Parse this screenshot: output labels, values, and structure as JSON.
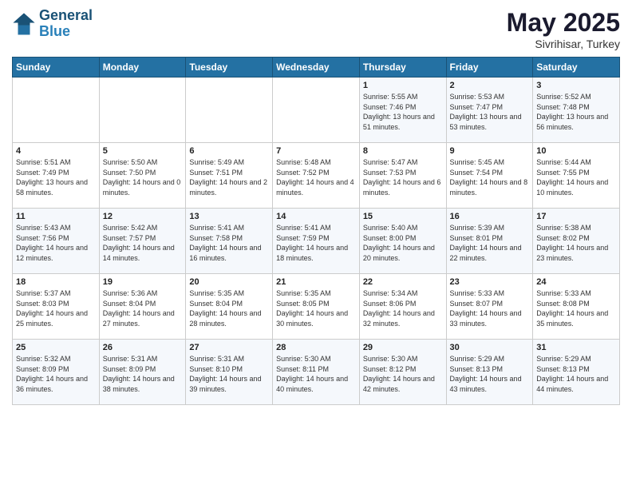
{
  "logo": {
    "line1": "General",
    "line2": "Blue"
  },
  "title": "May 2025",
  "subtitle": "Sivrihisar, Turkey",
  "days_header": [
    "Sunday",
    "Monday",
    "Tuesday",
    "Wednesday",
    "Thursday",
    "Friday",
    "Saturday"
  ],
  "weeks": [
    [
      {
        "day": "",
        "sunrise": "",
        "sunset": "",
        "daylight": ""
      },
      {
        "day": "",
        "sunrise": "",
        "sunset": "",
        "daylight": ""
      },
      {
        "day": "",
        "sunrise": "",
        "sunset": "",
        "daylight": ""
      },
      {
        "day": "",
        "sunrise": "",
        "sunset": "",
        "daylight": ""
      },
      {
        "day": "1",
        "sunrise": "Sunrise: 5:55 AM",
        "sunset": "Sunset: 7:46 PM",
        "daylight": "Daylight: 13 hours and 51 minutes."
      },
      {
        "day": "2",
        "sunrise": "Sunrise: 5:53 AM",
        "sunset": "Sunset: 7:47 PM",
        "daylight": "Daylight: 13 hours and 53 minutes."
      },
      {
        "day": "3",
        "sunrise": "Sunrise: 5:52 AM",
        "sunset": "Sunset: 7:48 PM",
        "daylight": "Daylight: 13 hours and 56 minutes."
      }
    ],
    [
      {
        "day": "4",
        "sunrise": "Sunrise: 5:51 AM",
        "sunset": "Sunset: 7:49 PM",
        "daylight": "Daylight: 13 hours and 58 minutes."
      },
      {
        "day": "5",
        "sunrise": "Sunrise: 5:50 AM",
        "sunset": "Sunset: 7:50 PM",
        "daylight": "Daylight: 14 hours and 0 minutes."
      },
      {
        "day": "6",
        "sunrise": "Sunrise: 5:49 AM",
        "sunset": "Sunset: 7:51 PM",
        "daylight": "Daylight: 14 hours and 2 minutes."
      },
      {
        "day": "7",
        "sunrise": "Sunrise: 5:48 AM",
        "sunset": "Sunset: 7:52 PM",
        "daylight": "Daylight: 14 hours and 4 minutes."
      },
      {
        "day": "8",
        "sunrise": "Sunrise: 5:47 AM",
        "sunset": "Sunset: 7:53 PM",
        "daylight": "Daylight: 14 hours and 6 minutes."
      },
      {
        "day": "9",
        "sunrise": "Sunrise: 5:45 AM",
        "sunset": "Sunset: 7:54 PM",
        "daylight": "Daylight: 14 hours and 8 minutes."
      },
      {
        "day": "10",
        "sunrise": "Sunrise: 5:44 AM",
        "sunset": "Sunset: 7:55 PM",
        "daylight": "Daylight: 14 hours and 10 minutes."
      }
    ],
    [
      {
        "day": "11",
        "sunrise": "Sunrise: 5:43 AM",
        "sunset": "Sunset: 7:56 PM",
        "daylight": "Daylight: 14 hours and 12 minutes."
      },
      {
        "day": "12",
        "sunrise": "Sunrise: 5:42 AM",
        "sunset": "Sunset: 7:57 PM",
        "daylight": "Daylight: 14 hours and 14 minutes."
      },
      {
        "day": "13",
        "sunrise": "Sunrise: 5:41 AM",
        "sunset": "Sunset: 7:58 PM",
        "daylight": "Daylight: 14 hours and 16 minutes."
      },
      {
        "day": "14",
        "sunrise": "Sunrise: 5:41 AM",
        "sunset": "Sunset: 7:59 PM",
        "daylight": "Daylight: 14 hours and 18 minutes."
      },
      {
        "day": "15",
        "sunrise": "Sunrise: 5:40 AM",
        "sunset": "Sunset: 8:00 PM",
        "daylight": "Daylight: 14 hours and 20 minutes."
      },
      {
        "day": "16",
        "sunrise": "Sunrise: 5:39 AM",
        "sunset": "Sunset: 8:01 PM",
        "daylight": "Daylight: 14 hours and 22 minutes."
      },
      {
        "day": "17",
        "sunrise": "Sunrise: 5:38 AM",
        "sunset": "Sunset: 8:02 PM",
        "daylight": "Daylight: 14 hours and 23 minutes."
      }
    ],
    [
      {
        "day": "18",
        "sunrise": "Sunrise: 5:37 AM",
        "sunset": "Sunset: 8:03 PM",
        "daylight": "Daylight: 14 hours and 25 minutes."
      },
      {
        "day": "19",
        "sunrise": "Sunrise: 5:36 AM",
        "sunset": "Sunset: 8:04 PM",
        "daylight": "Daylight: 14 hours and 27 minutes."
      },
      {
        "day": "20",
        "sunrise": "Sunrise: 5:35 AM",
        "sunset": "Sunset: 8:04 PM",
        "daylight": "Daylight: 14 hours and 28 minutes."
      },
      {
        "day": "21",
        "sunrise": "Sunrise: 5:35 AM",
        "sunset": "Sunset: 8:05 PM",
        "daylight": "Daylight: 14 hours and 30 minutes."
      },
      {
        "day": "22",
        "sunrise": "Sunrise: 5:34 AM",
        "sunset": "Sunset: 8:06 PM",
        "daylight": "Daylight: 14 hours and 32 minutes."
      },
      {
        "day": "23",
        "sunrise": "Sunrise: 5:33 AM",
        "sunset": "Sunset: 8:07 PM",
        "daylight": "Daylight: 14 hours and 33 minutes."
      },
      {
        "day": "24",
        "sunrise": "Sunrise: 5:33 AM",
        "sunset": "Sunset: 8:08 PM",
        "daylight": "Daylight: 14 hours and 35 minutes."
      }
    ],
    [
      {
        "day": "25",
        "sunrise": "Sunrise: 5:32 AM",
        "sunset": "Sunset: 8:09 PM",
        "daylight": "Daylight: 14 hours and 36 minutes."
      },
      {
        "day": "26",
        "sunrise": "Sunrise: 5:31 AM",
        "sunset": "Sunset: 8:09 PM",
        "daylight": "Daylight: 14 hours and 38 minutes."
      },
      {
        "day": "27",
        "sunrise": "Sunrise: 5:31 AM",
        "sunset": "Sunset: 8:10 PM",
        "daylight": "Daylight: 14 hours and 39 minutes."
      },
      {
        "day": "28",
        "sunrise": "Sunrise: 5:30 AM",
        "sunset": "Sunset: 8:11 PM",
        "daylight": "Daylight: 14 hours and 40 minutes."
      },
      {
        "day": "29",
        "sunrise": "Sunrise: 5:30 AM",
        "sunset": "Sunset: 8:12 PM",
        "daylight": "Daylight: 14 hours and 42 minutes."
      },
      {
        "day": "30",
        "sunrise": "Sunrise: 5:29 AM",
        "sunset": "Sunset: 8:13 PM",
        "daylight": "Daylight: 14 hours and 43 minutes."
      },
      {
        "day": "31",
        "sunrise": "Sunrise: 5:29 AM",
        "sunset": "Sunset: 8:13 PM",
        "daylight": "Daylight: 14 hours and 44 minutes."
      }
    ]
  ]
}
